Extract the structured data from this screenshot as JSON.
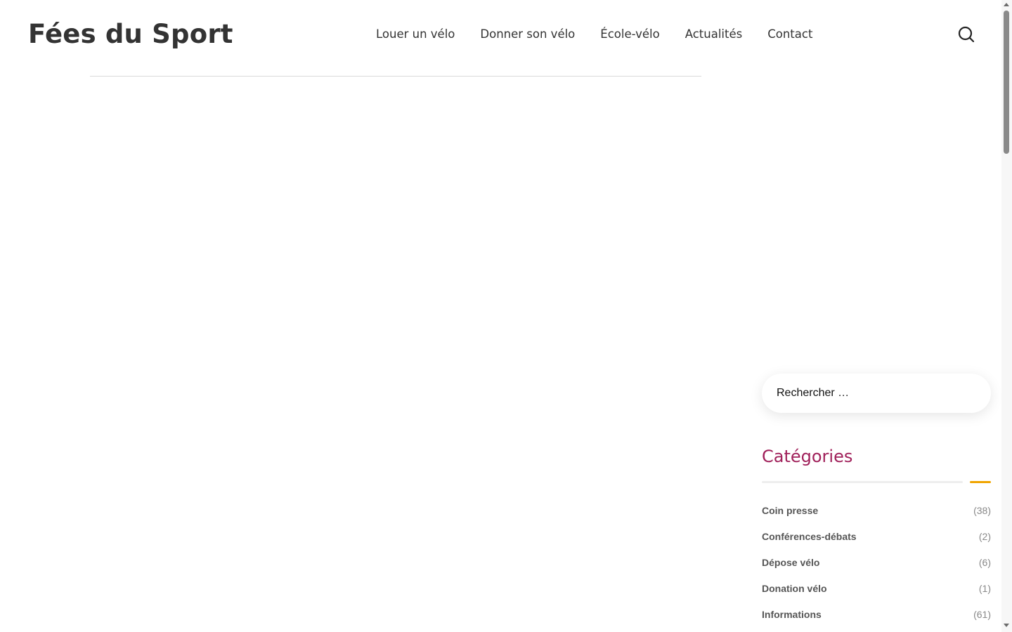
{
  "site": {
    "logo": "Fées du Sport"
  },
  "nav": {
    "items": [
      {
        "label": "Louer un vélo"
      },
      {
        "label": "Donner son vélo"
      },
      {
        "label": "École-vélo"
      },
      {
        "label": "Actualités"
      },
      {
        "label": "Contact"
      }
    ],
    "search_icon": "search-icon"
  },
  "sidebar": {
    "search": {
      "placeholder": "Rechercher …"
    },
    "categories": {
      "title": "Catégories",
      "items": [
        {
          "label": "Coin presse",
          "count": "(38)"
        },
        {
          "label": "Conférences-débats",
          "count": "(2)"
        },
        {
          "label": "Dépose vélo",
          "count": "(6)"
        },
        {
          "label": "Donation vélo",
          "count": "(1)"
        },
        {
          "label": "Informations",
          "count": "(61)"
        }
      ]
    }
  },
  "colors": {
    "text": "#333333",
    "widget_title": "#a0205a",
    "accent_line": "#f0a500",
    "muted_line": "#eeeeee"
  }
}
